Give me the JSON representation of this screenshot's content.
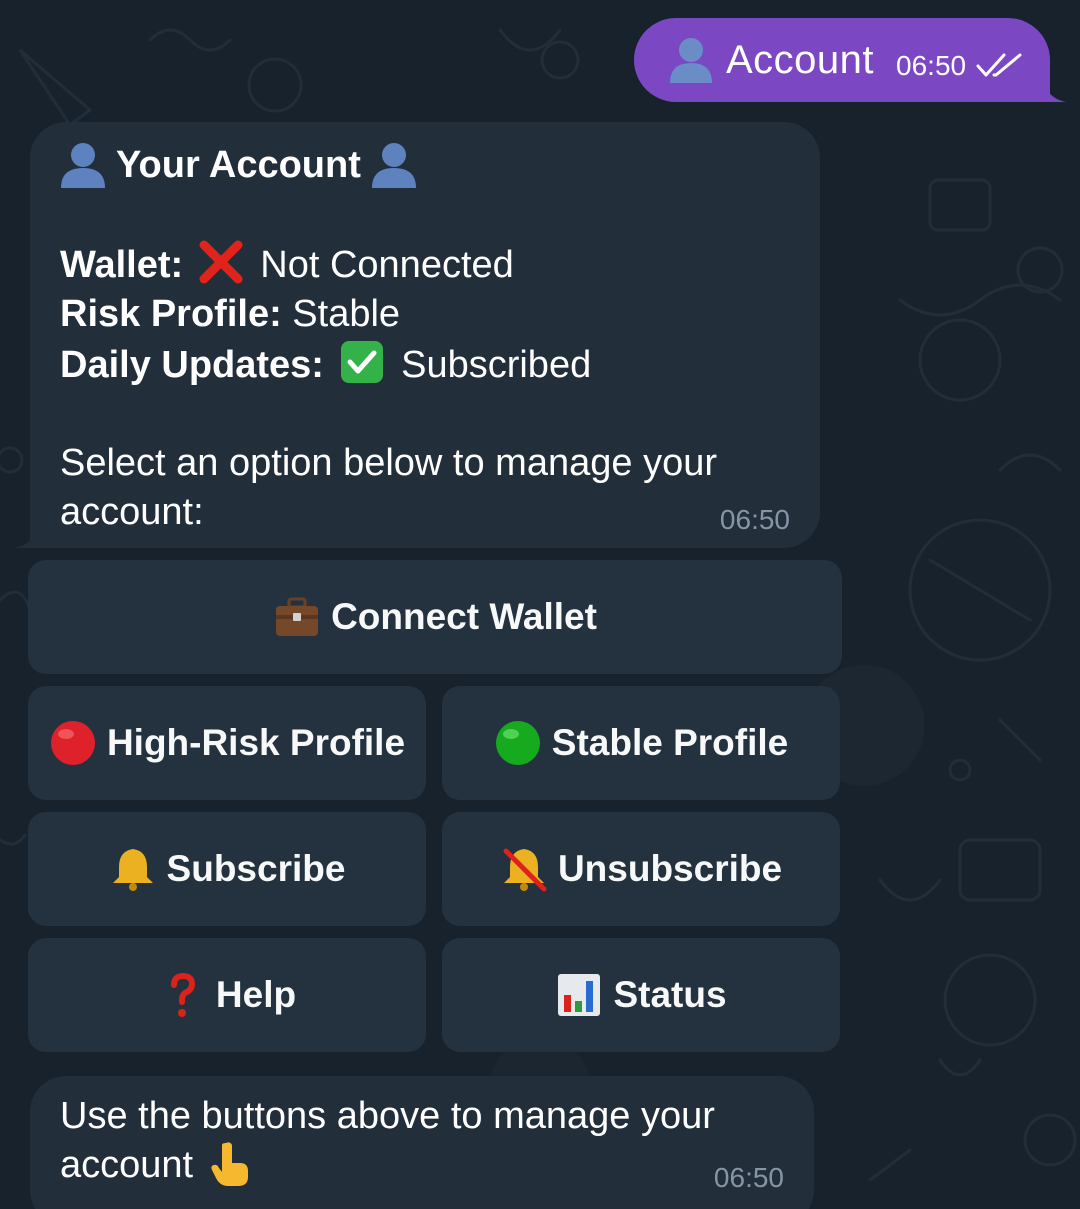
{
  "outgoing": {
    "text": "Account",
    "time": "06:50",
    "status_icon": "double-check-icon",
    "bubble_color": "#7b47c2"
  },
  "account_message": {
    "title": "Your Account",
    "wallet_label": "Wallet:",
    "wallet_value": "Not Connected",
    "risk_label": "Risk Profile:",
    "risk_value": "Stable",
    "updates_label": "Daily Updates:",
    "updates_value": "Subscribed",
    "prompt": "Select an option below to manage your account:",
    "time": "06:50"
  },
  "keyboard": {
    "connect_wallet": "Connect Wallet",
    "high_risk": "High-Risk Profile",
    "stable": "Stable Profile",
    "subscribe": "Subscribe",
    "unsubscribe": "Unsubscribe",
    "help": "Help",
    "status": "Status"
  },
  "footer_message": {
    "text": "Use the buttons above to manage your account",
    "time": "06:50"
  },
  "colors": {
    "background": "#17222c",
    "bubble": "#222e3a",
    "button": "#253341",
    "muted_text": "#8595a6"
  }
}
